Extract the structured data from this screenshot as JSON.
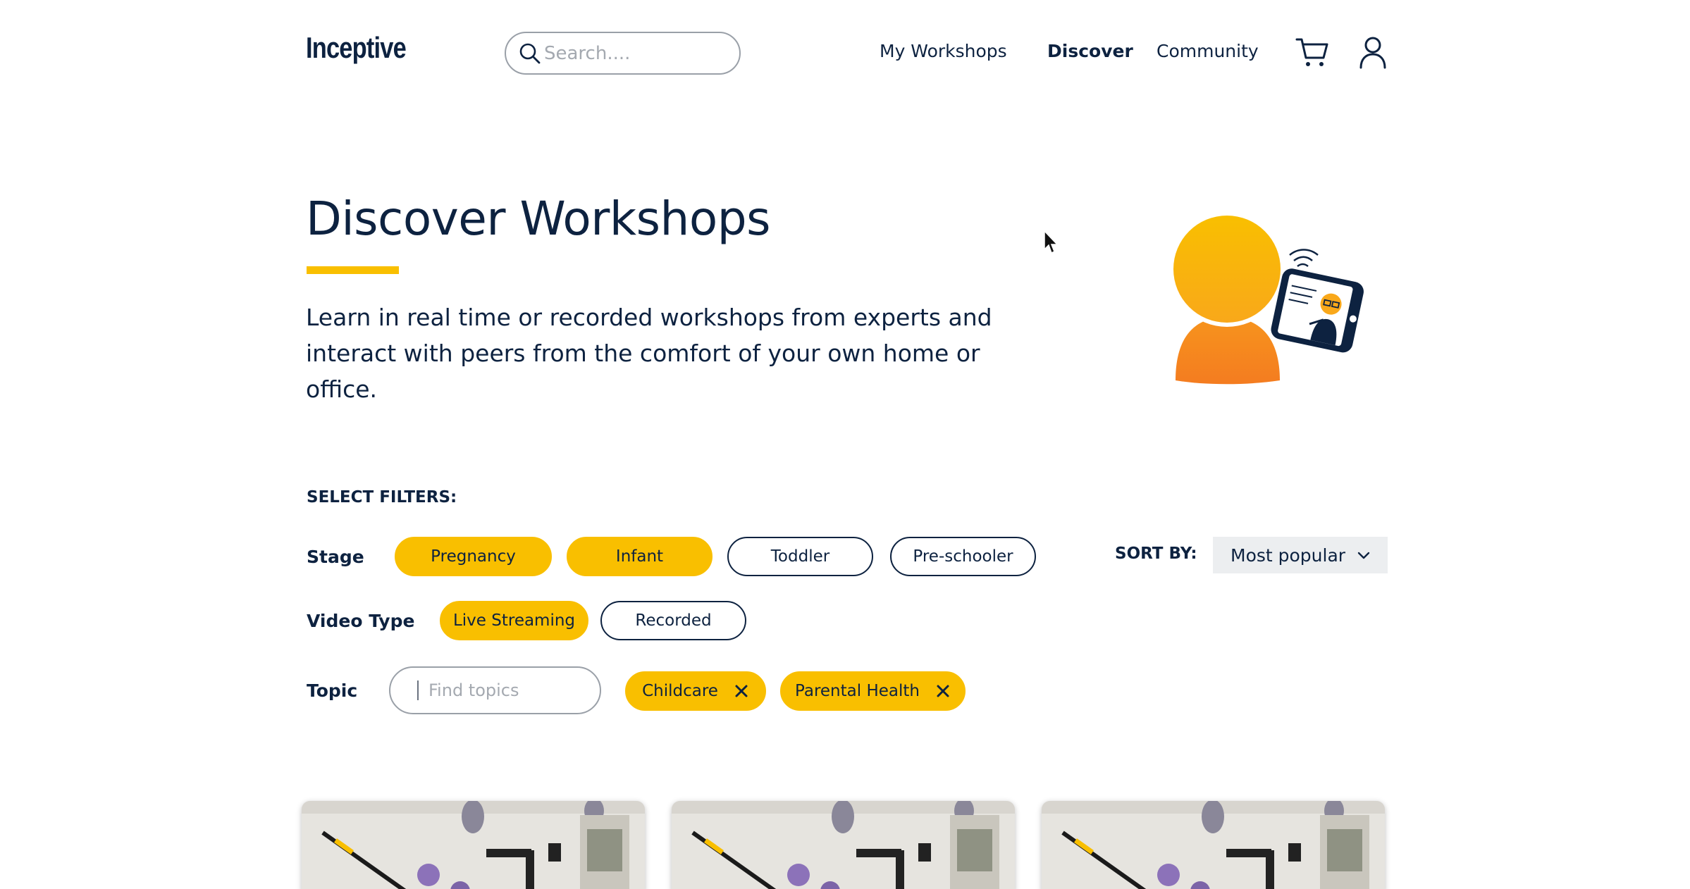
{
  "header": {
    "logo": "Inceptive",
    "search_placeholder": "Search....",
    "nav": [
      "My Workshops",
      "Discover",
      "Community"
    ],
    "active_nav": "Discover",
    "icons": [
      "cart-icon",
      "user-icon"
    ]
  },
  "hero": {
    "title": "Discover Workshops",
    "description": "Learn in real time or recorded workshops from experts and interact with peers from the comfort of your own home or office."
  },
  "filters": {
    "heading": "SELECT FILTERS:",
    "stage": {
      "label": "Stage",
      "options": [
        {
          "label": "Pregnancy",
          "selected": true
        },
        {
          "label": "Infant",
          "selected": true
        },
        {
          "label": "Toddler",
          "selected": false
        },
        {
          "label": "Pre-schooler",
          "selected": false
        }
      ]
    },
    "video_type": {
      "label": "Video Type",
      "options": [
        {
          "label": "Live Streaming",
          "selected": true
        },
        {
          "label": "Recorded",
          "selected": false
        }
      ]
    },
    "topic": {
      "label": "Topic",
      "placeholder": "Find topics",
      "selected_tags": [
        "Childcare",
        "Parental Health"
      ]
    },
    "sort": {
      "label": "SORT BY:",
      "value": "Most popular"
    }
  },
  "colors": {
    "primary_text": "#0d2240",
    "accent_yellow": "#f9bf00",
    "accent_orange": "#f7941d",
    "sort_bg": "#eceef0"
  }
}
